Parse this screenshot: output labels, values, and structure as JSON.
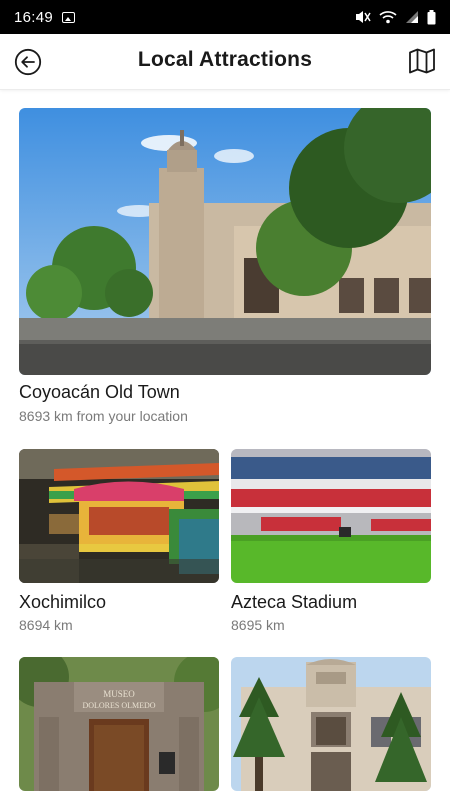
{
  "status_bar": {
    "time": "16:49",
    "icons": [
      "image-notification-icon",
      "mute-icon",
      "wifi-icon",
      "signal-icon",
      "battery-icon"
    ]
  },
  "header": {
    "title": "Local Attractions",
    "back_icon": "back-arrow-icon",
    "map_icon": "map-icon"
  },
  "attractions": [
    {
      "name": "Coyoacán Old Town",
      "distance": "8693 km from your location"
    },
    {
      "name": "Xochimilco",
      "distance": "8694 km"
    },
    {
      "name": "Azteca Stadium",
      "distance": "8695 km"
    },
    {
      "name": "",
      "distance": ""
    },
    {
      "name": "",
      "distance": ""
    }
  ],
  "colors": {
    "status_bar": "#000000",
    "header_bg": "#ffffff",
    "title": "#1a1a1a",
    "secondary_text": "#7a7a7a"
  }
}
